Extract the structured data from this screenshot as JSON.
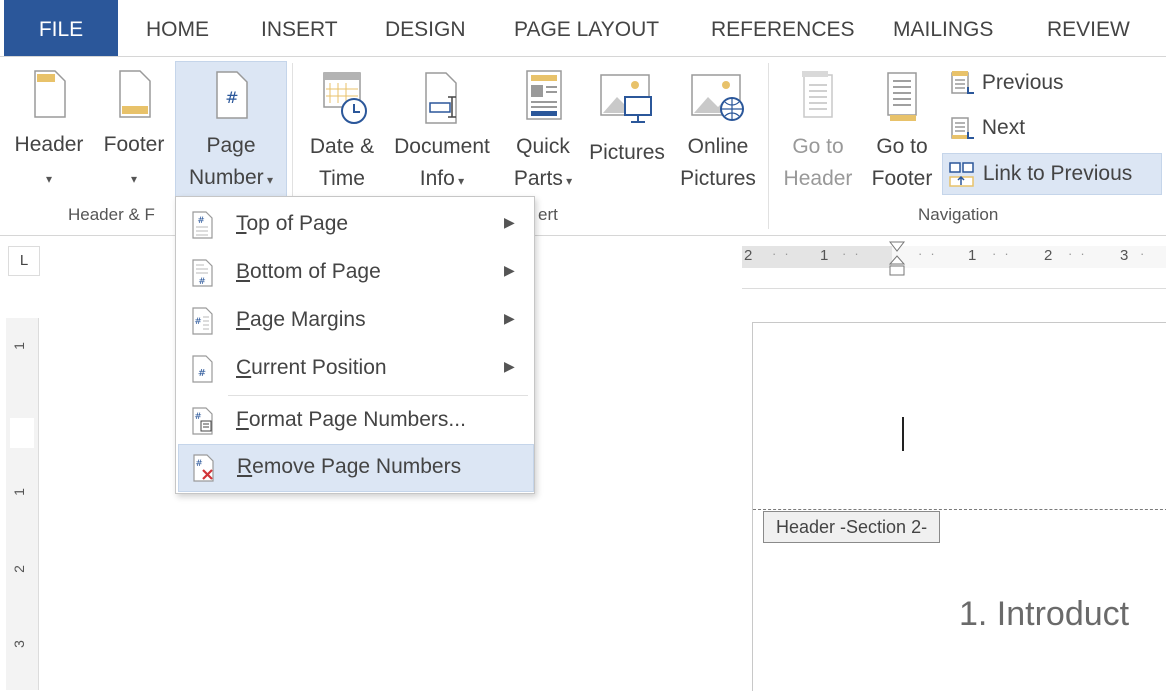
{
  "tabs": [
    "FILE",
    "HOME",
    "INSERT",
    "DESIGN",
    "PAGE LAYOUT",
    "REFERENCES",
    "MAILINGS",
    "REVIEW"
  ],
  "ribbon": {
    "header": {
      "label": "Header"
    },
    "footer": {
      "label": "Footer"
    },
    "page_number": {
      "line1": "Page",
      "line2": "Number"
    },
    "date_time": {
      "line1": "Date &",
      "line2": "Time"
    },
    "document_info": {
      "line1": "Document",
      "line2": "Info"
    },
    "quick_parts": {
      "line1": "Quick",
      "line2": "Parts"
    },
    "pictures": {
      "label": "Pictures"
    },
    "online_pictures": {
      "line1": "Online",
      "line2": "Pictures"
    },
    "go_to_header": {
      "line1": "Go to",
      "line2": "Header"
    },
    "go_to_footer": {
      "line1": "Go to",
      "line2": "Footer"
    },
    "previous": {
      "label": "Previous"
    },
    "next": {
      "label": "Next"
    },
    "link_to_previous": {
      "label": "Link to Previous"
    },
    "groups": {
      "header_footer": "Header & F",
      "insert": "ert",
      "navigation": "Navigation"
    }
  },
  "menu": {
    "items": [
      {
        "first": "T",
        "rest": "op of Page",
        "submenu": true
      },
      {
        "first": "B",
        "rest": "ottom of Page",
        "submenu": true
      },
      {
        "first": "P",
        "rest": "age Margins",
        "submenu": true
      },
      {
        "first": "C",
        "rest": "urrent Position",
        "submenu": true
      },
      {
        "first": "F",
        "rest": "ormat Page Numbers...",
        "submenu": false
      },
      {
        "first": "R",
        "rest": "emove Page Numbers",
        "submenu": false
      }
    ]
  },
  "ruler": {
    "tab_selector": "L",
    "h_numbers": [
      "2",
      "1",
      "1",
      "2",
      "3"
    ],
    "v_numbers": [
      "1",
      "1",
      "2",
      "3"
    ]
  },
  "document": {
    "header_tag": "Header -Section 2-",
    "heading": "1. Introduct"
  },
  "colors": {
    "file_tab": "#2b579a",
    "highlight": "#dce6f4",
    "accent": "#e8c26a"
  }
}
